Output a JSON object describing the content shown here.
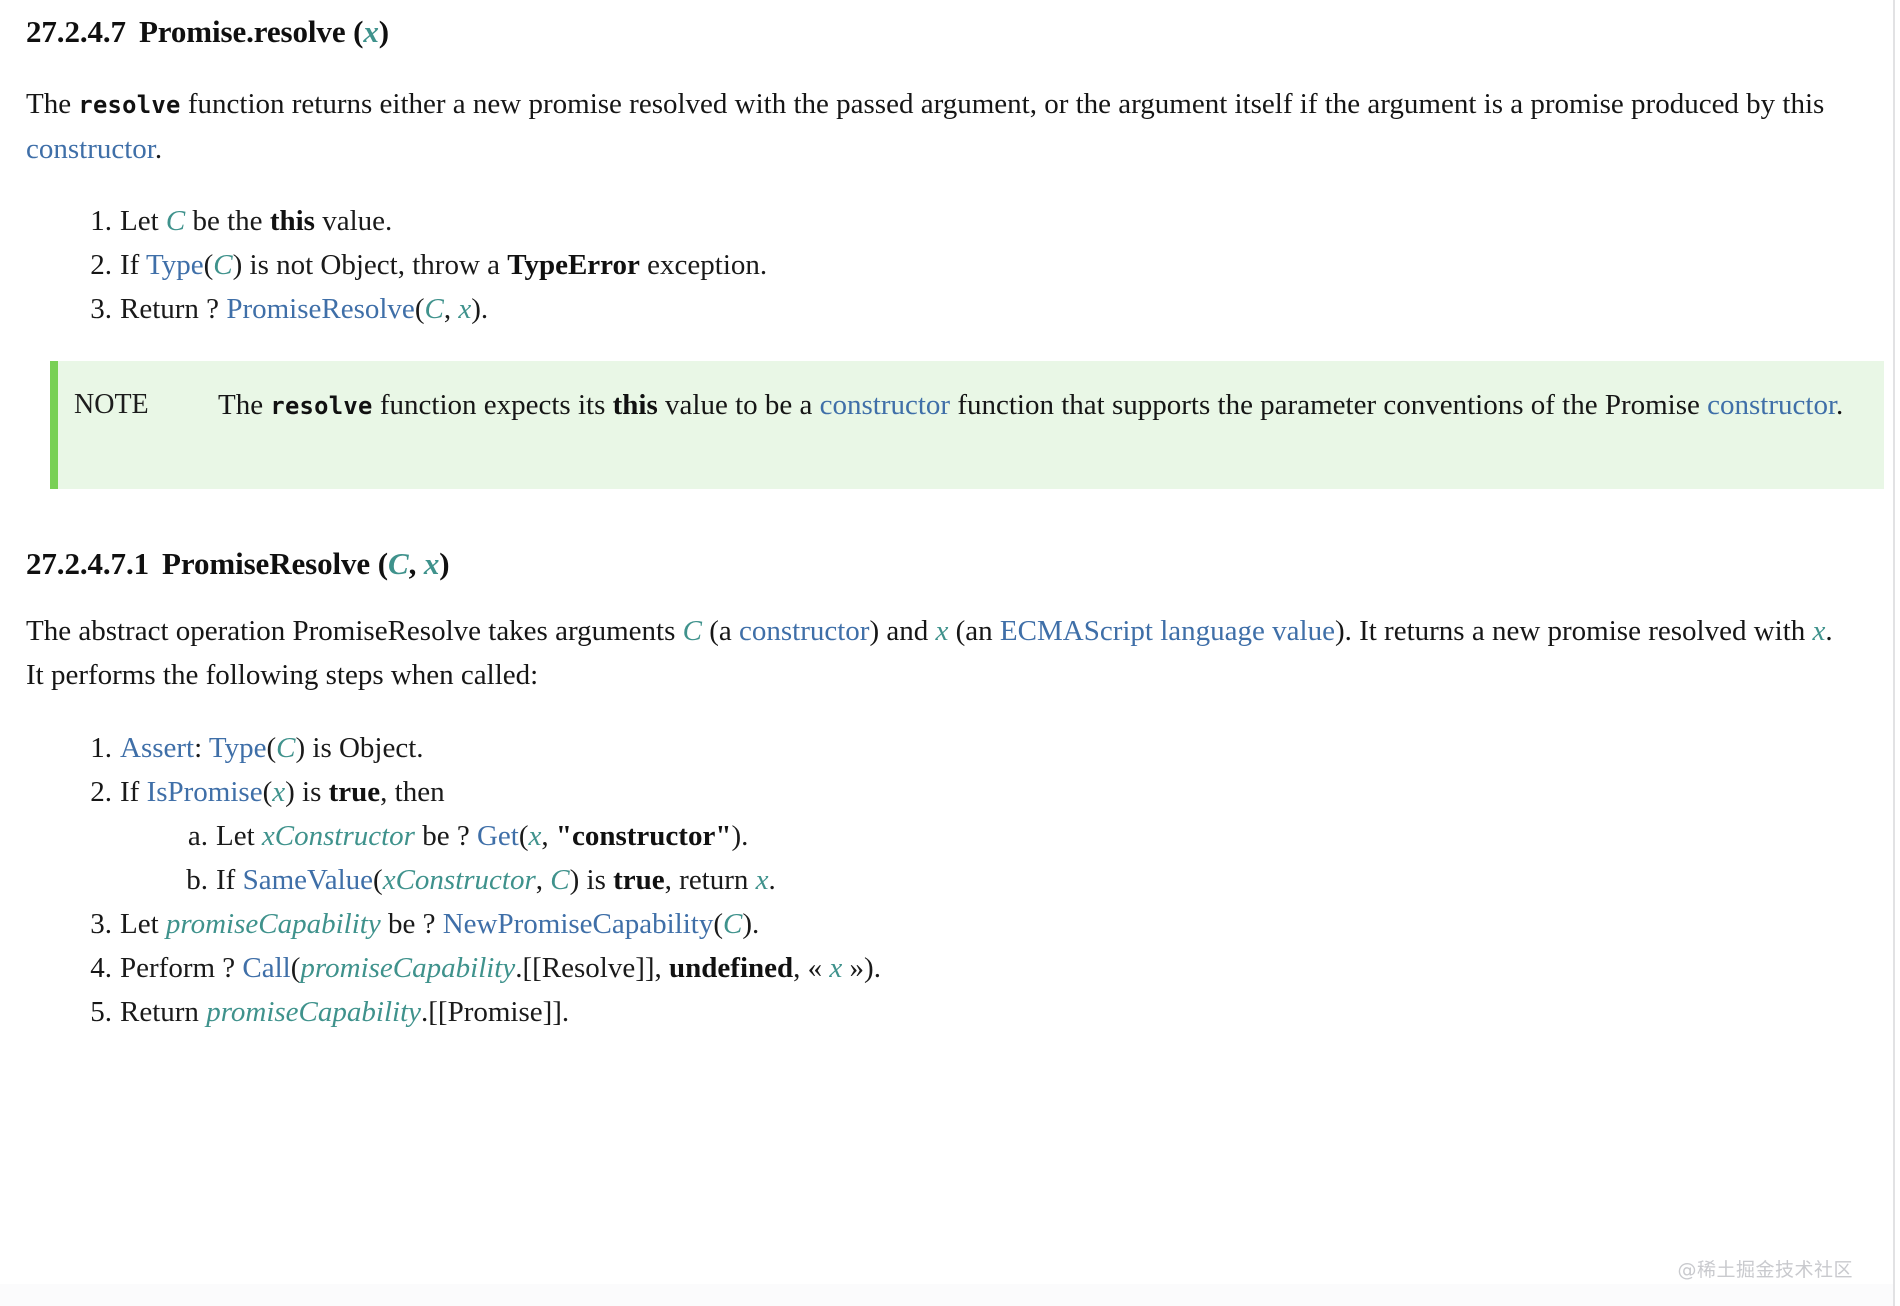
{
  "document": {
    "watermark": "@稀土掘金技术社区"
  },
  "clause_resolve": {
    "section_number": "27.2.4.7",
    "name": "Promise.resolve",
    "paren_open": "(",
    "param_x": "x",
    "paren_close": ")",
    "intro": {
      "t1": "The ",
      "code_resolve": "resolve",
      "t2": " function returns either a new promise resolved with the passed argument, or the argument itself if the argument is a promise produced by this ",
      "link_constructor": "constructor",
      "t3": "."
    },
    "steps": [
      {
        "marker": "1.",
        "parts": [
          {
            "type": "text",
            "text": "Let "
          },
          {
            "type": "var",
            "text": "C"
          },
          {
            "type": "text",
            "text": " be the "
          },
          {
            "type": "kw",
            "text": "this"
          },
          {
            "type": "text",
            "text": " value."
          }
        ]
      },
      {
        "marker": "2.",
        "parts": [
          {
            "type": "text",
            "text": "If "
          },
          {
            "type": "link",
            "text": "Type"
          },
          {
            "type": "text",
            "text": "("
          },
          {
            "type": "var",
            "text": "C"
          },
          {
            "type": "text",
            "text": ") is not Object, throw a "
          },
          {
            "type": "kw",
            "text": "TypeError"
          },
          {
            "type": "text",
            "text": " exception."
          }
        ]
      },
      {
        "marker": "3.",
        "parts": [
          {
            "type": "text",
            "text": "Return ? "
          },
          {
            "type": "link",
            "text": "PromiseResolve"
          },
          {
            "type": "text",
            "text": "("
          },
          {
            "type": "var",
            "text": "C"
          },
          {
            "type": "text",
            "text": ", "
          },
          {
            "type": "var",
            "text": "x"
          },
          {
            "type": "text",
            "text": ")."
          }
        ]
      }
    ],
    "note": {
      "label": "NOTE",
      "t1": "The ",
      "code_resolve": "resolve",
      "t2": " function expects its ",
      "kw_this": "this",
      "t3": " value to be a ",
      "link_constructor_1": "constructor",
      "t4": " function that supports the parameter conventions of the Promise ",
      "link_constructor_2": "constructor",
      "t5": "."
    }
  },
  "clause_promiseresolve": {
    "section_number": "27.2.4.7.1",
    "name": "PromiseResolve",
    "paren_open": "(",
    "param_c": "C",
    "param_sep": ",",
    "param_x": "x",
    "paren_close": ")",
    "intro": {
      "t1": "The abstract operation PromiseResolve takes arguments ",
      "var_c": "C",
      "t2": " (a ",
      "link_constructor": "constructor",
      "t3": ") and ",
      "var_x": "x",
      "t4": " (an ",
      "link_language_value": "ECMAScript language value",
      "t5": "). It returns a new promise resolved with ",
      "var_x2": "x",
      "t6": ". It performs the following steps when called:"
    },
    "steps": [
      {
        "marker": "1.",
        "parts": [
          {
            "type": "link",
            "text": "Assert"
          },
          {
            "type": "text",
            "text": ": "
          },
          {
            "type": "link",
            "text": "Type"
          },
          {
            "type": "text",
            "text": "("
          },
          {
            "type": "var",
            "text": "C"
          },
          {
            "type": "text",
            "text": ") is Object."
          }
        ]
      },
      {
        "marker": "2.",
        "parts": [
          {
            "type": "text",
            "text": "If "
          },
          {
            "type": "link",
            "text": "IsPromise"
          },
          {
            "type": "text",
            "text": "("
          },
          {
            "type": "var",
            "text": "x"
          },
          {
            "type": "text",
            "text": ") is "
          },
          {
            "type": "kw",
            "text": "true"
          },
          {
            "type": "text",
            "text": ", then"
          }
        ],
        "substeps": [
          {
            "marker": "a.",
            "parts": [
              {
                "type": "text",
                "text": "Let "
              },
              {
                "type": "var",
                "text": "xConstructor"
              },
              {
                "type": "text",
                "text": " be ? "
              },
              {
                "type": "link",
                "text": "Get"
              },
              {
                "type": "text",
                "text": "("
              },
              {
                "type": "var",
                "text": "x"
              },
              {
                "type": "text",
                "text": ", "
              },
              {
                "type": "str",
                "text": "\"constructor\""
              },
              {
                "type": "text",
                "text": ")."
              }
            ]
          },
          {
            "marker": "b.",
            "parts": [
              {
                "type": "text",
                "text": "If "
              },
              {
                "type": "link",
                "text": "SameValue"
              },
              {
                "type": "text",
                "text": "("
              },
              {
                "type": "var",
                "text": "xConstructor"
              },
              {
                "type": "text",
                "text": ", "
              },
              {
                "type": "var",
                "text": "C"
              },
              {
                "type": "text",
                "text": ") is "
              },
              {
                "type": "kw",
                "text": "true"
              },
              {
                "type": "text",
                "text": ", return "
              },
              {
                "type": "var",
                "text": "x"
              },
              {
                "type": "text",
                "text": "."
              }
            ]
          }
        ]
      },
      {
        "marker": "3.",
        "parts": [
          {
            "type": "text",
            "text": "Let "
          },
          {
            "type": "var",
            "text": "promiseCapability"
          },
          {
            "type": "text",
            "text": " be ? "
          },
          {
            "type": "link",
            "text": "NewPromiseCapability"
          },
          {
            "type": "text",
            "text": "("
          },
          {
            "type": "var",
            "text": "C"
          },
          {
            "type": "text",
            "text": ")."
          }
        ]
      },
      {
        "marker": "4.",
        "parts": [
          {
            "type": "text",
            "text": "Perform ? "
          },
          {
            "type": "link",
            "text": "Call"
          },
          {
            "type": "text",
            "text": "("
          },
          {
            "type": "var",
            "text": "promiseCapability"
          },
          {
            "type": "text",
            "text": ".[[Resolve]], "
          },
          {
            "type": "kw",
            "text": "undefined"
          },
          {
            "type": "text",
            "text": ", « "
          },
          {
            "type": "var",
            "text": "x"
          },
          {
            "type": "text",
            "text": " »)."
          }
        ]
      },
      {
        "marker": "5.",
        "parts": [
          {
            "type": "text",
            "text": "Return "
          },
          {
            "type": "var",
            "text": "promiseCapability"
          },
          {
            "type": "text",
            "text": ".[[Promise]]."
          }
        ]
      }
    ]
  },
  "colors": {
    "link": "#3f6fa8",
    "variable": "#3f928c",
    "note_background": "#e9f7e6",
    "note_border": "#78d055",
    "text": "#161616"
  }
}
